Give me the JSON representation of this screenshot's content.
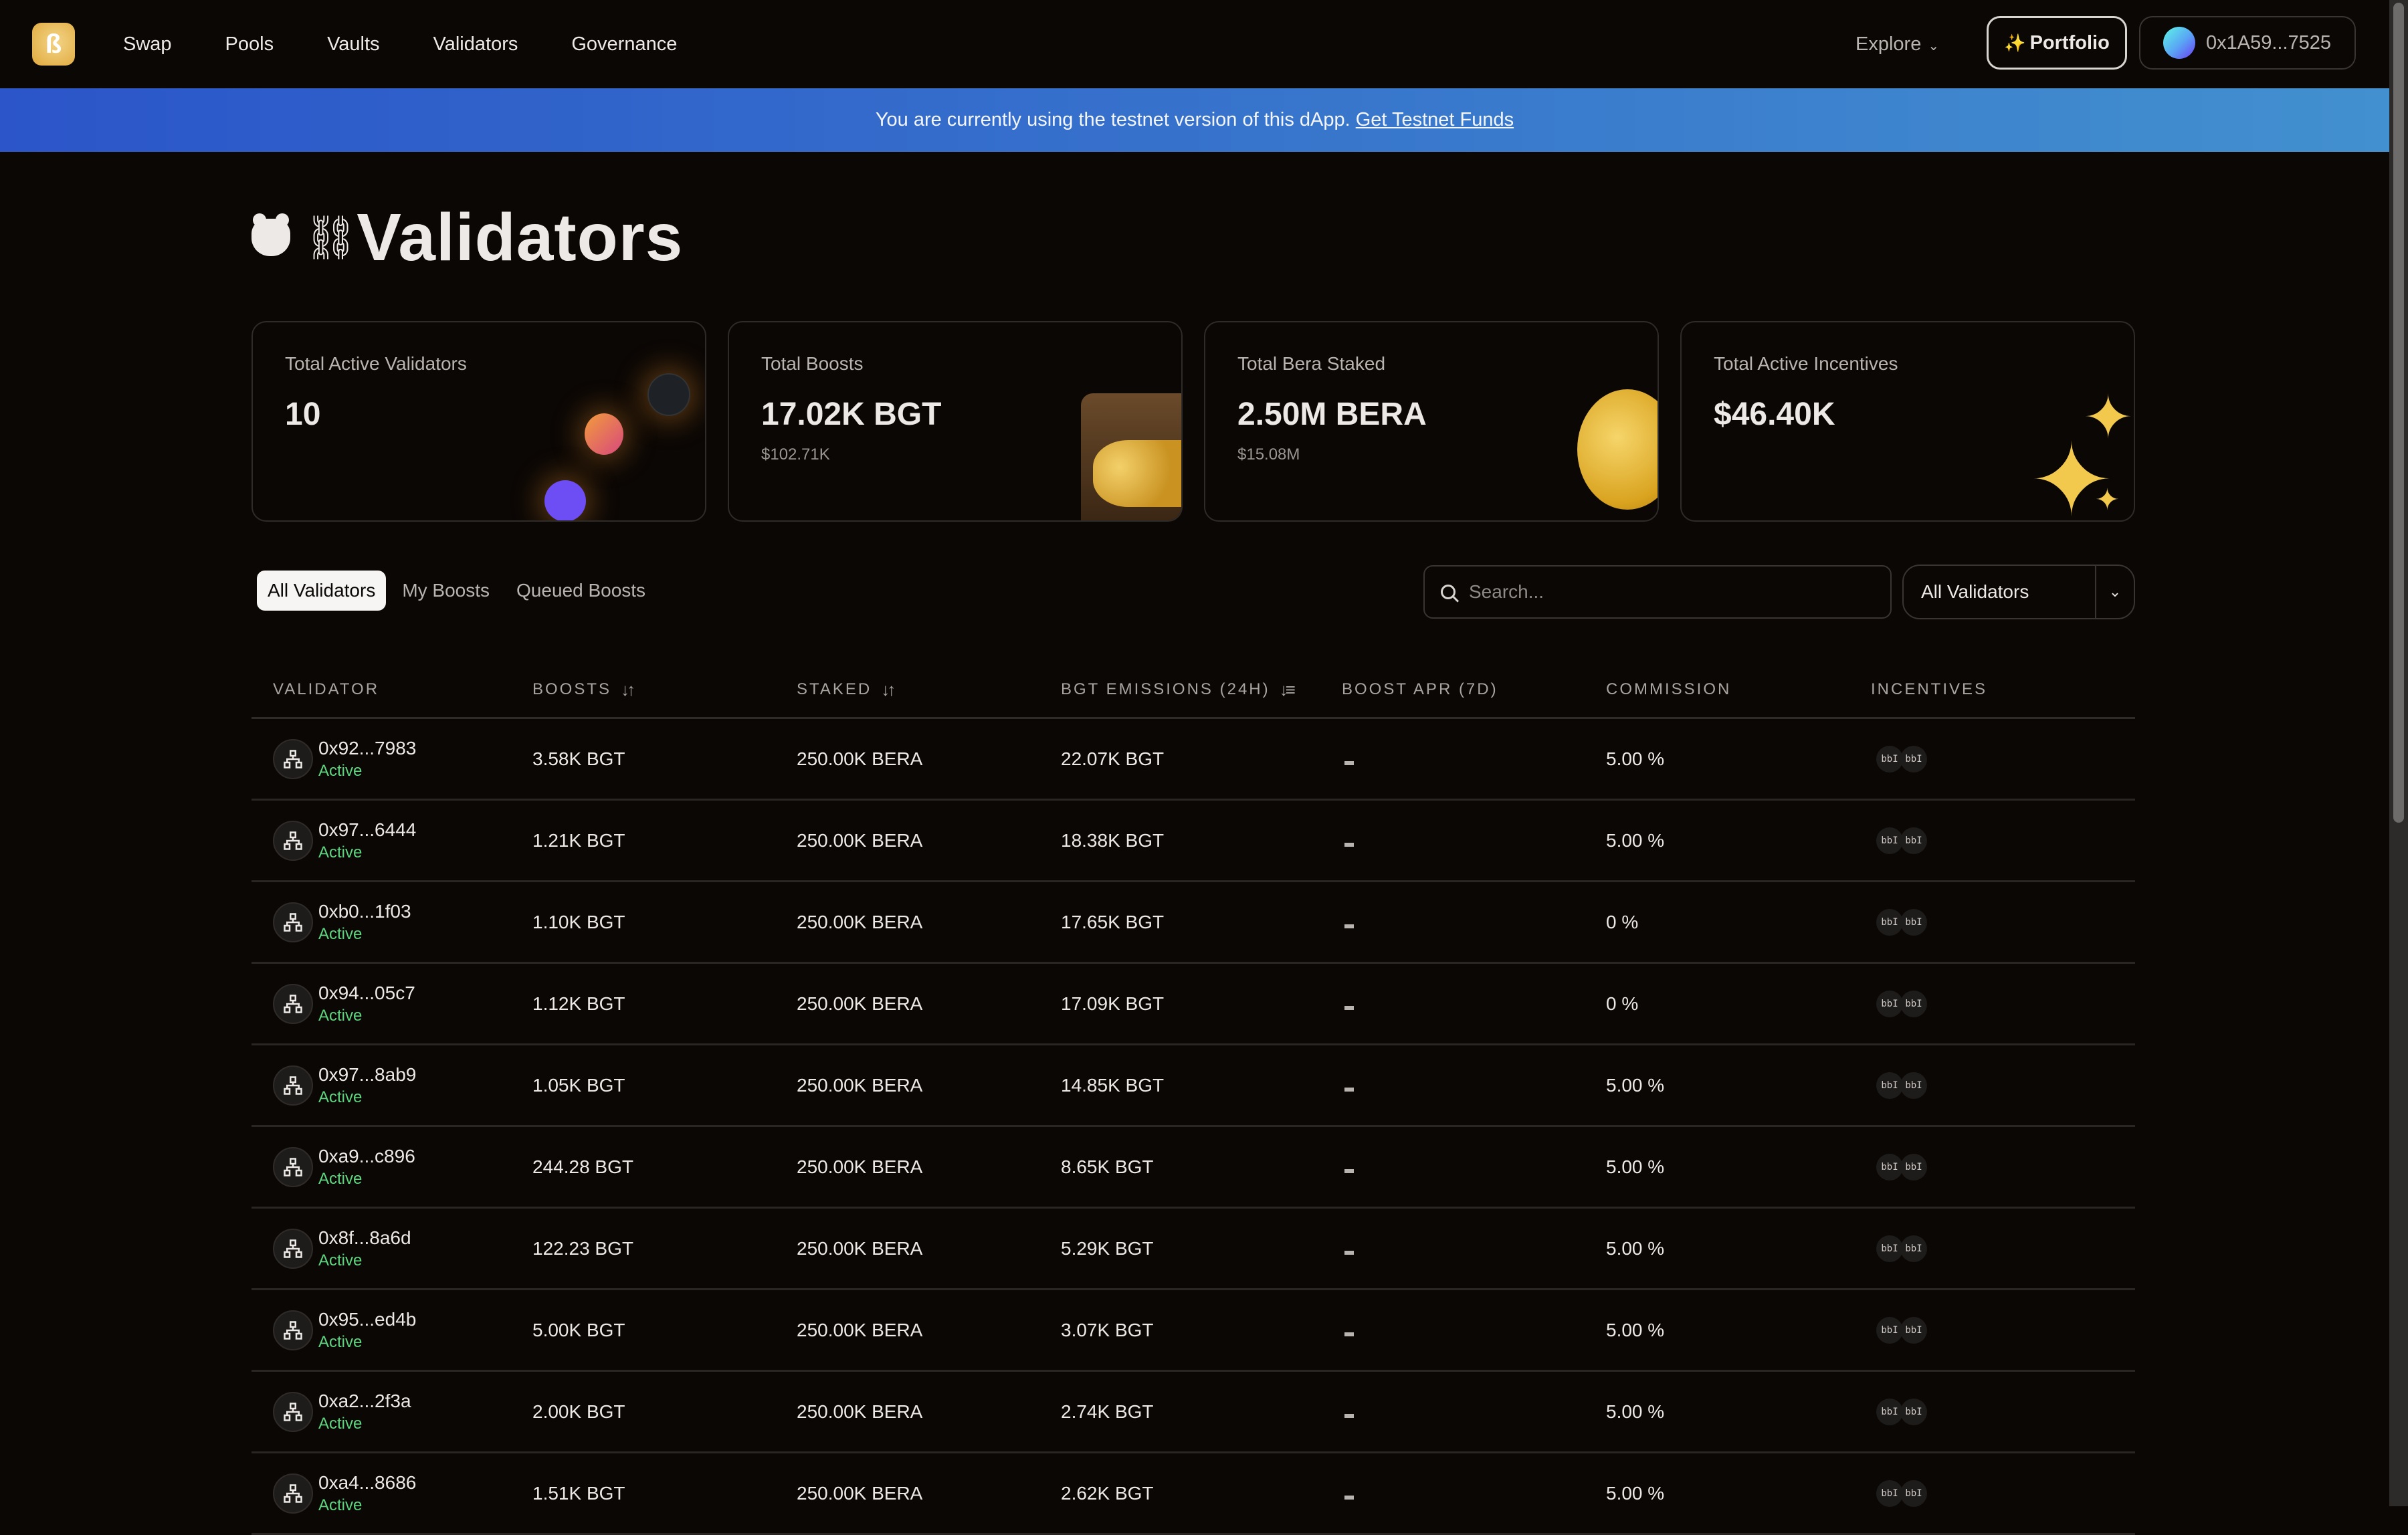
{
  "header": {
    "logo": "bera-logo",
    "nav": [
      "Swap",
      "Pools",
      "Vaults",
      "Validators",
      "Governance"
    ],
    "explore_label": "Explore",
    "portfolio_label": "Portfolio",
    "wallet_address": "0x1A59...7525"
  },
  "banner": {
    "text": "You are currently using the testnet version of this dApp.",
    "link": "Get Testnet Funds"
  },
  "page": {
    "title": "Validators",
    "title_icons": [
      "bear-icon",
      "chain-icon"
    ]
  },
  "cards": [
    {
      "label": "Total Active Validators",
      "value": "10",
      "sub": ""
    },
    {
      "label": "Total Boosts",
      "value": "17.02K BGT",
      "sub": "$102.71K"
    },
    {
      "label": "Total Bera Staked",
      "value": "2.50M BERA",
      "sub": "$15.08M"
    },
    {
      "label": "Total Active Incentives",
      "value": "$46.40K",
      "sub": ""
    }
  ],
  "tabs": [
    {
      "label": "All Validators",
      "active": true
    },
    {
      "label": "My Boosts",
      "active": false
    },
    {
      "label": "Queued Boosts",
      "active": false
    }
  ],
  "search": {
    "placeholder": "Search...",
    "value": ""
  },
  "filter": {
    "selected": "All Validators"
  },
  "table": {
    "columns": [
      "VALIDATOR",
      "BOOSTS",
      "STAKED",
      "BGT EMISSIONS (24H)",
      "BOOST APR (7D)",
      "COMMISSION",
      "INCENTIVES"
    ],
    "rows": [
      {
        "name": "0x92...7983",
        "status": "Active",
        "boosts": "3.58K BGT",
        "staked": "250.00K BERA",
        "emissions": "22.07K BGT",
        "apr": "-",
        "commission": "5.00 %",
        "incentives": [
          "bbI",
          "bbI"
        ]
      },
      {
        "name": "0x97...6444",
        "status": "Active",
        "boosts": "1.21K BGT",
        "staked": "250.00K BERA",
        "emissions": "18.38K BGT",
        "apr": "-",
        "commission": "5.00 %",
        "incentives": [
          "bbI",
          "bbI"
        ]
      },
      {
        "name": "0xb0...1f03",
        "status": "Active",
        "boosts": "1.10K BGT",
        "staked": "250.00K BERA",
        "emissions": "17.65K BGT",
        "apr": "-",
        "commission": "0 %",
        "incentives": [
          "bbI",
          "bbI"
        ]
      },
      {
        "name": "0x94...05c7",
        "status": "Active",
        "boosts": "1.12K BGT",
        "staked": "250.00K BERA",
        "emissions": "17.09K BGT",
        "apr": "-",
        "commission": "0 %",
        "incentives": [
          "bbI",
          "bbI"
        ]
      },
      {
        "name": "0x97...8ab9",
        "status": "Active",
        "boosts": "1.05K BGT",
        "staked": "250.00K BERA",
        "emissions": "14.85K BGT",
        "apr": "-",
        "commission": "5.00 %",
        "incentives": [
          "bbI",
          "bbI"
        ]
      },
      {
        "name": "0xa9...c896",
        "status": "Active",
        "boosts": "244.28 BGT",
        "staked": "250.00K BERA",
        "emissions": "8.65K BGT",
        "apr": "-",
        "commission": "5.00 %",
        "incentives": [
          "bbI",
          "bbI"
        ]
      },
      {
        "name": "0x8f...8a6d",
        "status": "Active",
        "boosts": "122.23 BGT",
        "staked": "250.00K BERA",
        "emissions": "5.29K BGT",
        "apr": "-",
        "commission": "5.00 %",
        "incentives": [
          "bbI",
          "bbI"
        ]
      },
      {
        "name": "0x95...ed4b",
        "status": "Active",
        "boosts": "5.00K BGT",
        "staked": "250.00K BERA",
        "emissions": "3.07K BGT",
        "apr": "-",
        "commission": "5.00 %",
        "incentives": [
          "bbI",
          "bbI"
        ]
      },
      {
        "name": "0xa2...2f3a",
        "status": "Active",
        "boosts": "2.00K BGT",
        "staked": "250.00K BERA",
        "emissions": "2.74K BGT",
        "apr": "-",
        "commission": "5.00 %",
        "incentives": [
          "bbI",
          "bbI"
        ]
      },
      {
        "name": "0xa4...8686",
        "status": "Active",
        "boosts": "1.51K BGT",
        "staked": "250.00K BERA",
        "emissions": "2.62K BGT",
        "apr": "-",
        "commission": "5.00 %",
        "incentives": [
          "bbI",
          "bbI"
        ]
      }
    ]
  },
  "colors": {
    "background": "#0b0705",
    "banner_start": "#2b55c9",
    "banner_end": "#4290cf",
    "active_status": "#5ed47f",
    "logo": "#e6b24a"
  }
}
